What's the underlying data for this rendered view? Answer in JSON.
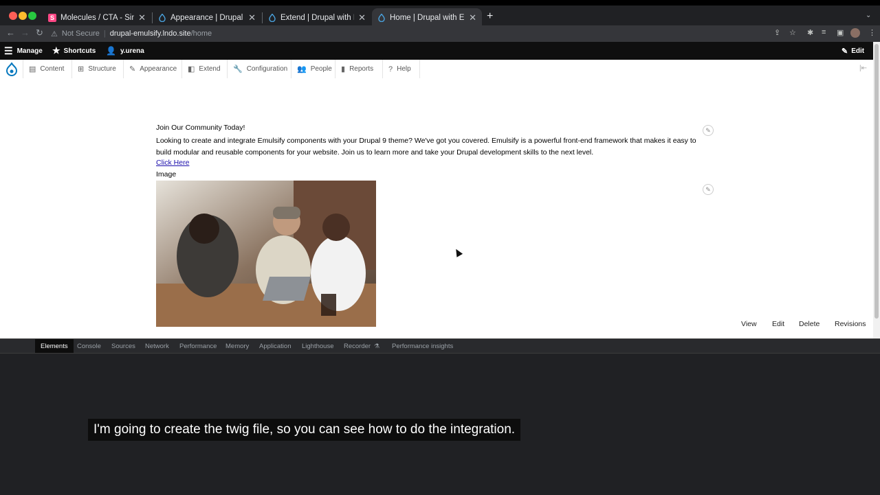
{
  "browser": {
    "tabs": [
      {
        "title": "Molecules / CTA - Simple CTA",
        "favicon": "storybook-icon"
      },
      {
        "title": "Appearance | Drupal with Emulsify",
        "favicon": "drupal-icon"
      },
      {
        "title": "Extend | Drupal with Emulsify",
        "favicon": "drupal-icon"
      },
      {
        "title": "Home | Drupal with Emulsify",
        "favicon": "drupal-icon",
        "active": true
      }
    ],
    "security": "Not Secure",
    "url_host": "drupal-emulsify.lndo.site",
    "url_path": "/home"
  },
  "toolbar": {
    "manage": "Manage",
    "shortcuts": "Shortcuts",
    "user": "y.urena",
    "edit": "Edit",
    "menu": [
      "Content",
      "Structure",
      "Appearance",
      "Extend",
      "Configuration",
      "People",
      "Reports",
      "Help"
    ]
  },
  "content": {
    "cta_title": "Join Our Community Today!",
    "cta_body": "Looking to create and integrate Emulsify components with your Drupal 9 theme? We've got you covered. Emulsify is a powerful front-end framework that makes it easy to build modular and reusable components for your website. Join us to learn more and take your Drupal development skills to the next level.",
    "cta_link": "Click Here",
    "image_label": "Image",
    "tasks": [
      "View",
      "Edit",
      "Delete",
      "Revisions"
    ]
  },
  "devtools": {
    "tabs": [
      "Elements",
      "Console",
      "Sources",
      "Network",
      "Performance",
      "Memory",
      "Application",
      "Lighthouse",
      "Recorder",
      "Performance insights"
    ],
    "active_tab": "Elements"
  },
  "caption": "I'm going to create the twig file, so you can see how to do the integration.",
  "colors": {
    "drupal_blue": "#0678be",
    "toolbar_black": "#0f0f0f",
    "devtools_bg": "#202124"
  }
}
